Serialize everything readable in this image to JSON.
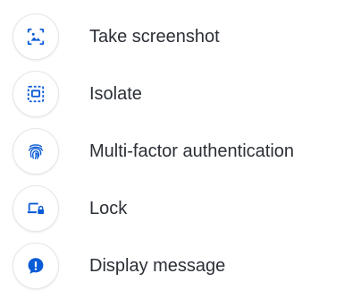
{
  "menu": {
    "items": [
      {
        "label": "Take screenshot",
        "icon": "screenshot-icon"
      },
      {
        "label": "Isolate",
        "icon": "isolate-icon"
      },
      {
        "label": "Multi-factor authentication",
        "icon": "fingerprint-icon"
      },
      {
        "label": "Lock",
        "icon": "laptop-lock-icon"
      },
      {
        "label": "Display message",
        "icon": "message-alert-icon"
      }
    ]
  },
  "colors": {
    "icon_accent": "#0a5bd6",
    "label_text": "#2b2f36",
    "circle_border": "#e3e6ea"
  }
}
